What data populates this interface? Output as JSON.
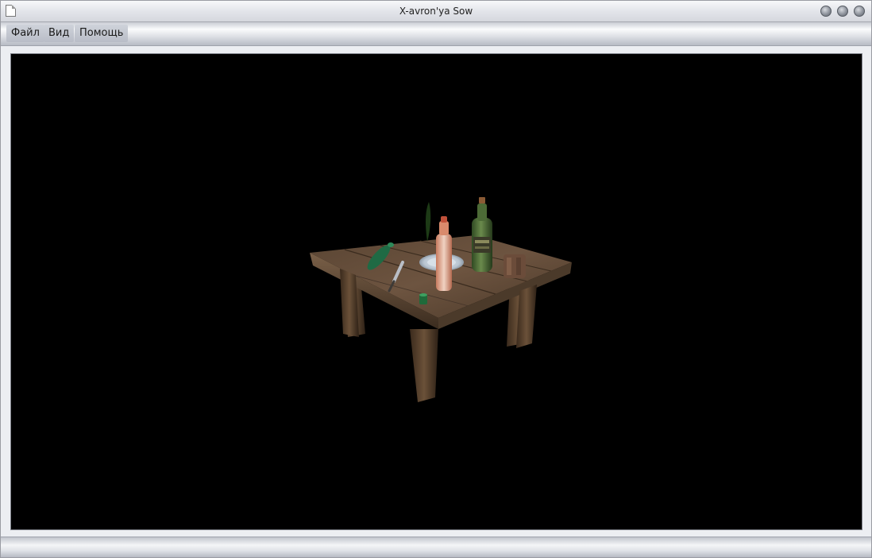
{
  "window": {
    "title": "X-avron'ya Sow"
  },
  "menu": {
    "items": [
      {
        "label": "Файл"
      },
      {
        "label": "Вид"
      },
      {
        "label": "Помощь"
      }
    ]
  },
  "scene": {
    "background": "#000000",
    "objects": [
      "wooden-table",
      "green-bottle-lying",
      "knife",
      "plate",
      "small-bottle",
      "green-wine-bottle",
      "wooden-mug",
      "green-shot-glass",
      "green-leaf"
    ]
  }
}
